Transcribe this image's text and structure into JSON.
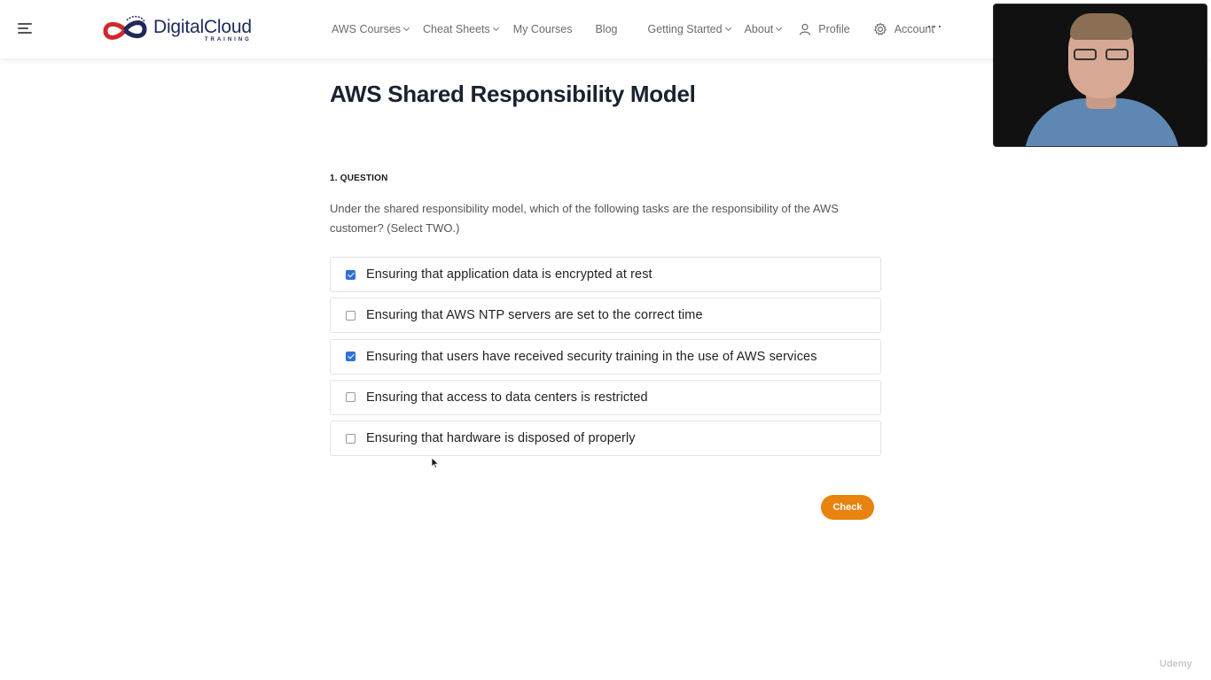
{
  "header": {
    "logo": {
      "name": "DigitalCloud",
      "sub": "TRAINING"
    },
    "nav": [
      {
        "label": "AWS Courses",
        "dropdown": true
      },
      {
        "label": "Cheat Sheets",
        "dropdown": true
      },
      {
        "label": "My Courses",
        "dropdown": false
      },
      {
        "label": "Blog",
        "dropdown": false
      },
      {
        "label": "Getting Started",
        "dropdown": true
      },
      {
        "label": "About",
        "dropdown": true
      },
      {
        "label": "Profile",
        "icon": "user-icon"
      },
      {
        "label": "Account",
        "icon": "gear-icon"
      }
    ],
    "more": "···"
  },
  "main": {
    "title": "AWS Shared Responsibility Model",
    "question_number": "1. QUESTION",
    "question_text": "Under the shared responsibility model, which of the following tasks are the responsibility of the AWS customer? (Select TWO.)",
    "options": [
      {
        "label": "Ensuring that application data is encrypted at rest",
        "checked": true
      },
      {
        "label": "Ensuring that AWS NTP servers are set to the correct time",
        "checked": false
      },
      {
        "label": "Ensuring that users have received security training in the use of AWS services",
        "checked": true
      },
      {
        "label": "Ensuring that access to data centers is restricted",
        "checked": false
      },
      {
        "label": "Ensuring that hardware is disposed of properly",
        "checked": false
      }
    ],
    "check_button": "Check"
  },
  "watermark": "Udemy",
  "colors": {
    "accent": "#e8830f",
    "checkbox": "#2f6fd8",
    "logo_red": "#d0282e",
    "logo_blue": "#1d2a5b"
  }
}
